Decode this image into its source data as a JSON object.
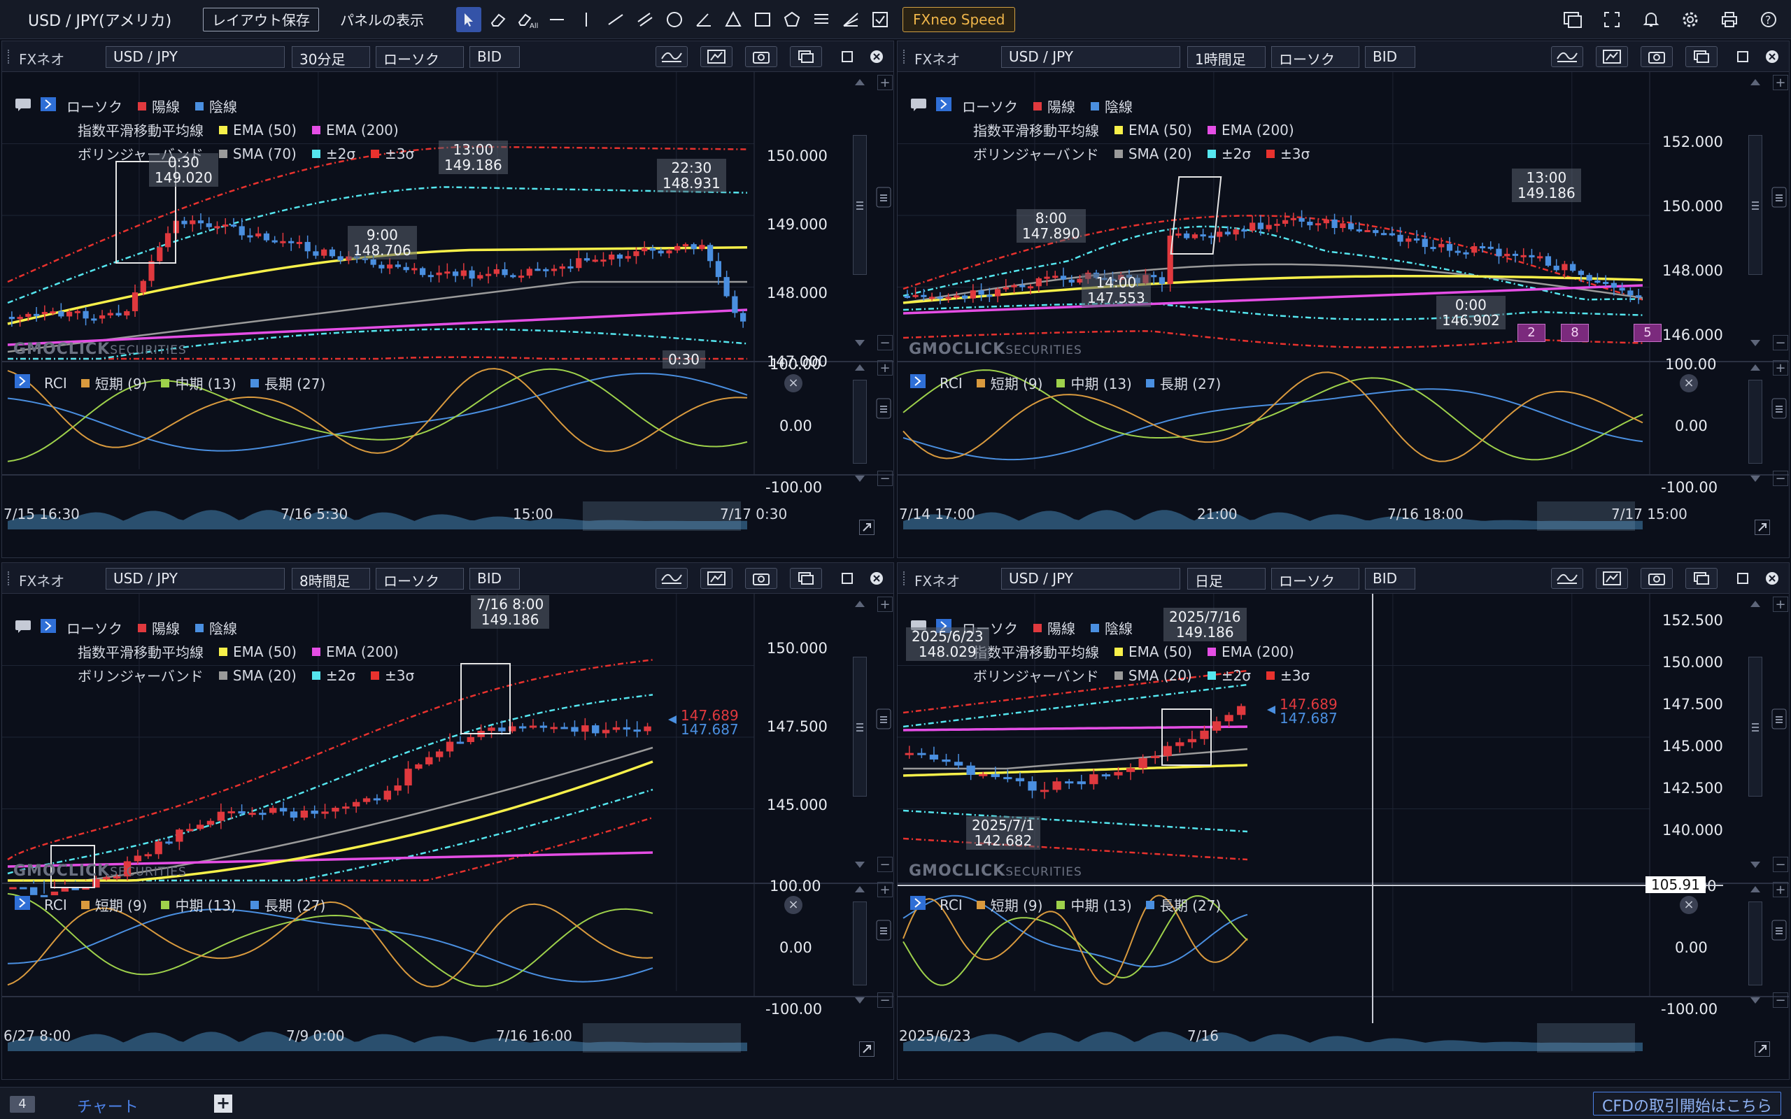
{
  "toolbar": {
    "title": "USD / JPY(アメリカ)",
    "layout_save": "レイアウト保存",
    "panel_display": "パネルの表示",
    "speed": "FXneo Speed"
  },
  "legend": {
    "candle": "ローソク",
    "up": "陽線",
    "down": "陰線",
    "ema_title": "指数平滑移動平均線",
    "ema50": "EMA (50)",
    "ema200": "EMA (200)",
    "bb_title": "ボリンジャーバンド",
    "sigma2": "±2σ",
    "sigma3": "±3σ"
  },
  "rci": {
    "title": "RCI",
    "short": "短期 (9)",
    "mid": "中期 (13)",
    "long": "長期 (27)"
  },
  "watermark": {
    "brand": "GMOCLICK",
    "sub": "SECURITIES"
  },
  "colors": {
    "up": "#e0393e",
    "down": "#4a8fe0",
    "ema50": "#f7f04a",
    "ema200": "#e54ee5",
    "sma": "#9a9a9a",
    "sigma2": "#55e6ef",
    "sigma3": "#e8322e",
    "rci_short": "#d99a3e",
    "rci_mid": "#9ed14b",
    "rci_long": "#4a8fe0"
  },
  "panels": [
    {
      "brand": "FXネオ",
      "symbol": "USD / JPY",
      "timeframe": "30分足",
      "chart_type": "ローソク",
      "price_type": "BID",
      "sma": "SMA (70)",
      "yaxis": [
        "150.000",
        "149.000",
        "148.000",
        "147.000"
      ],
      "rci_axis": [
        "100.00",
        "0.00",
        "-100.00"
      ],
      "xaxis": [
        "7/15 16:30",
        "7/16 5:30",
        "15:00",
        "7/17 0:30"
      ],
      "annotations": [
        {
          "time": "0:30",
          "price": "149.020"
        },
        {
          "time": "13:00",
          "price": "149.186"
        },
        {
          "time": "22:30",
          "price": "148.931"
        },
        {
          "time": "9:00",
          "price": "148.706"
        },
        {
          "time": "0:30",
          "price": ""
        }
      ]
    },
    {
      "brand": "FXネオ",
      "symbol": "USD / JPY",
      "timeframe": "1時間足",
      "chart_type": "ローソク",
      "price_type": "BID",
      "sma": "SMA (20)",
      "yaxis": [
        "152.000",
        "150.000",
        "148.000",
        "146.000"
      ],
      "rci_axis": [
        "100.00",
        "0.00",
        "-100.00"
      ],
      "xaxis": [
        "7/14 17:00",
        "21:00",
        "7/16 18:00",
        "7/17 15:00"
      ],
      "annotations": [
        {
          "time": "13:00",
          "price": "149.186"
        },
        {
          "time": "8:00",
          "price": "147.890"
        },
        {
          "time": "14:00",
          "price": "147.553"
        },
        {
          "time": "0:00",
          "price": "146.902"
        }
      ],
      "badges": [
        "2",
        "8",
        "5"
      ]
    },
    {
      "brand": "FXネオ",
      "symbol": "USD / JPY",
      "timeframe": "8時間足",
      "chart_type": "ローソク",
      "price_type": "BID",
      "sma": "SMA (20)",
      "yaxis": [
        "150.000",
        "147.500",
        "145.000"
      ],
      "rci_axis": [
        "100.00",
        "0.00",
        "-100.00"
      ],
      "xaxis": [
        "6/27 8:00",
        "7/9 0:00",
        "7/16 16:00"
      ],
      "annotations": [
        {
          "time": "7/16 8:00",
          "price": "149.186"
        }
      ],
      "ask": "147.689",
      "bid": "147.687"
    },
    {
      "brand": "FXネオ",
      "symbol": "USD / JPY",
      "timeframe": "日足",
      "chart_type": "ローソク",
      "price_type": "BID",
      "sma": "SMA (20)",
      "yaxis": [
        "152.500",
        "150.000",
        "147.500",
        "145.000",
        "142.500",
        "140.000"
      ],
      "rci_axis": [
        "100.00",
        "0.00",
        "-100.00"
      ],
      "xaxis": [
        "2025/6/23",
        "7/16"
      ],
      "annotations": [
        {
          "time": "2025/6/23",
          "price": "148.029"
        },
        {
          "time": "2025/7/16",
          "price": "149.186"
        },
        {
          "time": "2025/7/1",
          "price": "142.682"
        }
      ],
      "ask": "147.689",
      "bid": "147.687",
      "crosshair_value": "105.91"
    }
  ],
  "bottom": {
    "count": "4",
    "tab": "チャート",
    "cfd": "CFDの取引開始はこちら"
  }
}
